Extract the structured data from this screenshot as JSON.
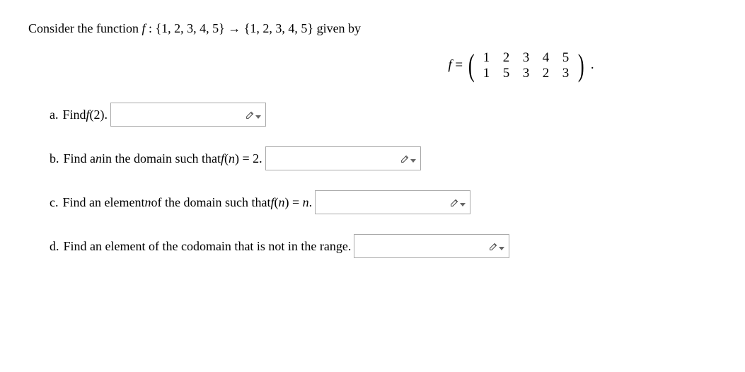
{
  "intro": {
    "prefix": "Consider the function ",
    "func_expr": "f : {1, 2, 3, 4, 5} → {1, 2, 3, 4, 5}",
    "suffix": " given by"
  },
  "matrix_display": {
    "lhs": "f =",
    "row1": [
      "1",
      "2",
      "3",
      "4",
      "5"
    ],
    "row2": [
      "1",
      "5",
      "3",
      "2",
      "3"
    ],
    "trailing": "."
  },
  "questions": {
    "a": {
      "label": "a. ",
      "text1": "Find ",
      "math": "f(2)",
      "text2": "."
    },
    "b": {
      "label": "b. ",
      "text1": "Find a ",
      "var": "n",
      "text2": " in the domain such that ",
      "math": "f(n) = 2",
      "text3": "."
    },
    "c": {
      "label": "c. ",
      "text1": "Find an element ",
      "var": "n",
      "text2": " of the domain such that ",
      "math": "f(n) = n",
      "text3": "."
    },
    "d": {
      "label": "d. ",
      "text1": "Find an element of the codomain that is not in the range."
    }
  }
}
